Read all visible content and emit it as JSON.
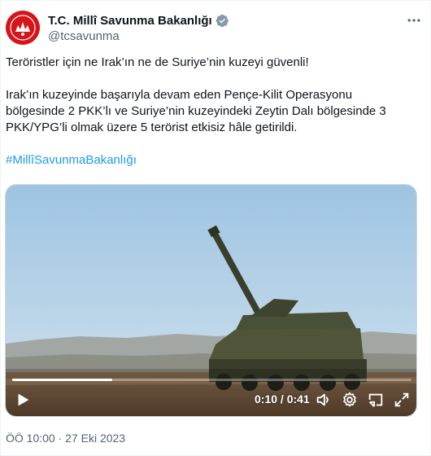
{
  "account": {
    "display_name": "T.C. Millî Savunma Bakanlığı",
    "handle": "@tcsavunma",
    "verified": true,
    "verified_color": "#829aab",
    "avatar_color": "#d7141a"
  },
  "tweet": {
    "paragraph_1": "Teröristler için ne Irak’ın ne de Suriye’nin kuzeyi güvenli!",
    "paragraph_2_line_1": "Irak’ın kuzeyinde başarıyla devam eden Pençe-Kilit Operasyonu",
    "paragraph_2_line_2": "bölgesinde 2 PKK’lı ve Suriye’nin kuzeyindeki Zeytin Dalı bölgesinde 3",
    "paragraph_2_line_3": "PKK/YPG’li olmak üzere 5 terörist etkisiz hâle getirildi.",
    "hashtag": "#MillîSavunmaBakanlığı",
    "timestamp": "ÖÖ 10:00 · 27 Eki 2023"
  },
  "video": {
    "time_display": "0:10 / 0:41",
    "progress": 0.25,
    "icons": [
      "play-icon",
      "volume-icon",
      "settings-icon",
      "picture-in-picture-icon",
      "fullscreen-icon"
    ]
  },
  "colors": {
    "text": "#0f1419",
    "secondary": "#536471",
    "link": "#1d9bf0"
  }
}
